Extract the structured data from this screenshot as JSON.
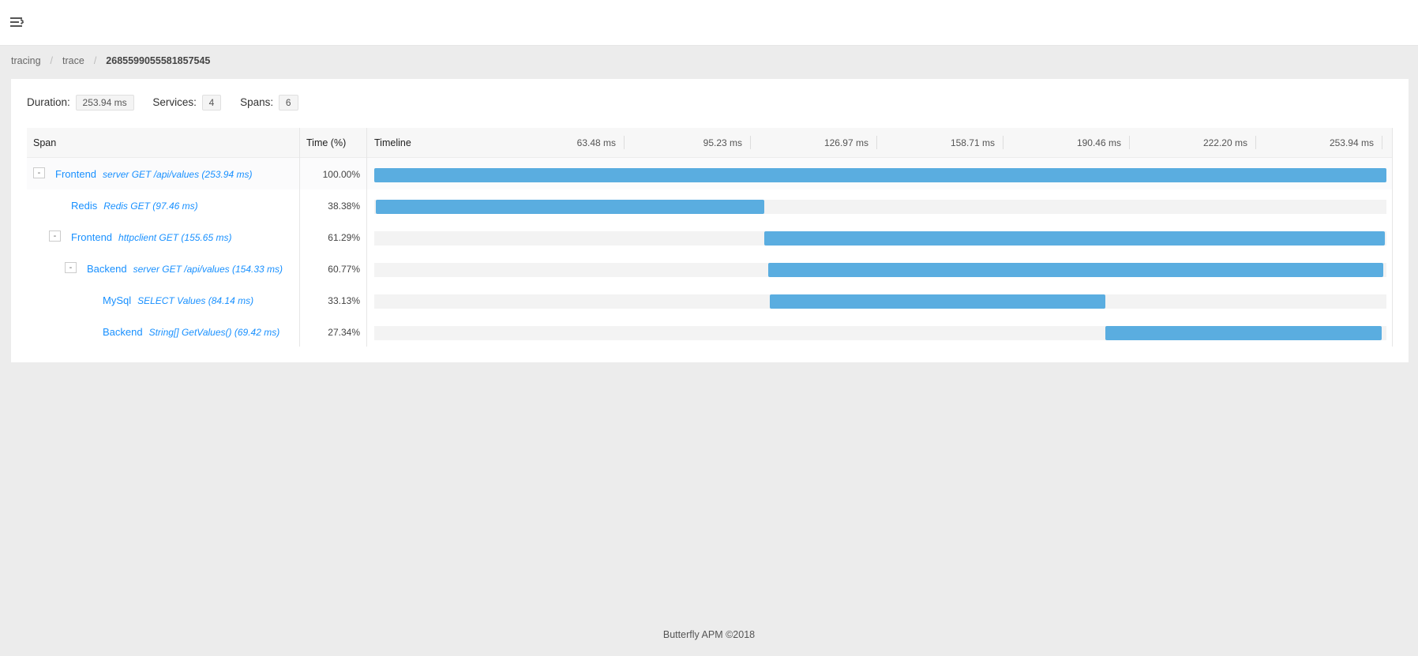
{
  "breadcrumb": {
    "item1": "tracing",
    "item2": "trace",
    "current": "2685599055581857545"
  },
  "summary": {
    "duration_label": "Duration:",
    "duration_value": "253.94 ms",
    "services_label": "Services:",
    "services_value": "4",
    "spans_label": "Spans:",
    "spans_value": "6"
  },
  "table": {
    "headers": {
      "span": "Span",
      "time": "Time (%)",
      "timeline": "Timeline"
    },
    "ticks": [
      "63.48 ms",
      "95.23 ms",
      "126.97 ms",
      "158.71 ms",
      "190.46 ms",
      "222.20 ms",
      "253.94 ms"
    ],
    "rows": [
      {
        "service": "Frontend",
        "operation": "server GET /api/values (253.94 ms)",
        "percent": "100.00%",
        "toggle": "-",
        "depth": 0,
        "start_ms": 0,
        "duration_ms": 253.94
      },
      {
        "service": "Redis",
        "operation": "Redis GET (97.46 ms)",
        "percent": "38.38%",
        "toggle": "",
        "depth": 1,
        "start_ms": 0.4,
        "duration_ms": 97.46
      },
      {
        "service": "Frontend",
        "operation": "httpclient GET (155.65 ms)",
        "percent": "61.29%",
        "toggle": "-",
        "depth": 1,
        "start_ms": 97.9,
        "duration_ms": 155.65
      },
      {
        "service": "Backend",
        "operation": "server GET /api/values (154.33 ms)",
        "percent": "60.77%",
        "toggle": "-",
        "depth": 2,
        "start_ms": 98.9,
        "duration_ms": 154.33
      },
      {
        "service": "MySql",
        "operation": "SELECT Values (84.14 ms)",
        "percent": "33.13%",
        "toggle": "",
        "depth": 3,
        "start_ms": 99.3,
        "duration_ms": 84.14
      },
      {
        "service": "Backend",
        "operation": "String[] GetValues() (69.42 ms)",
        "percent": "27.34%",
        "toggle": "",
        "depth": 3,
        "start_ms": 183.4,
        "duration_ms": 69.42
      }
    ]
  },
  "total_ms": 253.94,
  "footer": "Butterfly APM ©2018",
  "colors": {
    "bar": "#5aade0",
    "link": "#1890ff"
  }
}
